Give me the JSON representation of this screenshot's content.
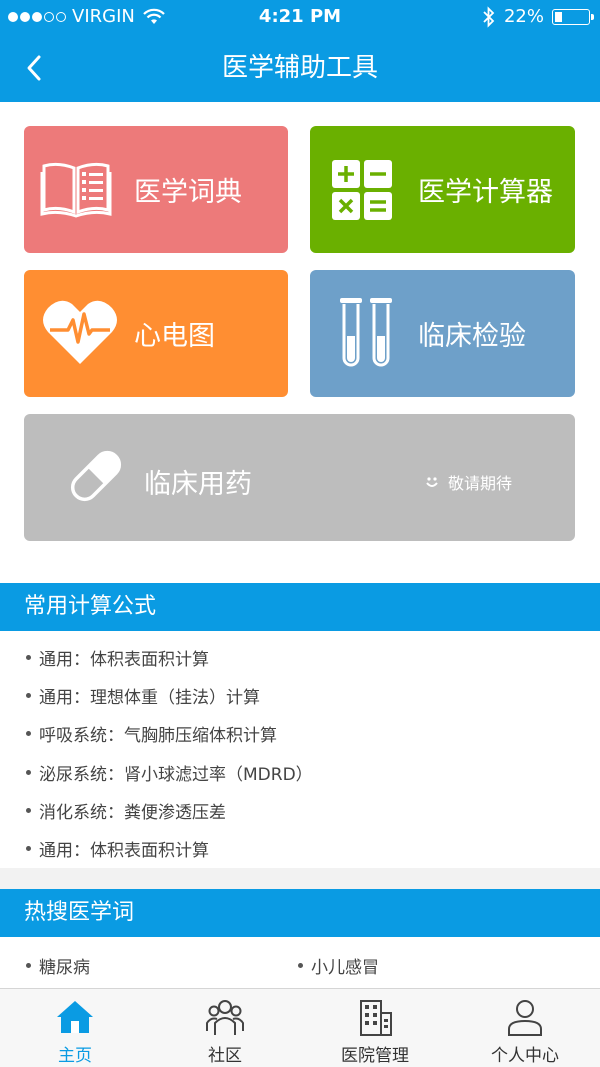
{
  "status": {
    "carrier": "VIRGIN",
    "time": "4:21 PM",
    "battery": "22%",
    "battery_level": 0.22
  },
  "nav": {
    "title": "医学辅助工具"
  },
  "tiles": {
    "dictionary": {
      "label": "医学词典",
      "color": "#ed7a7a"
    },
    "calculator": {
      "label": "医学计算器",
      "color": "#6ab000"
    },
    "ecg": {
      "label": "心电图",
      "color": "#ff8e32"
    },
    "lab": {
      "label": "临床检验",
      "color": "#6ea0c9"
    },
    "drugs": {
      "label": "临床用药",
      "coming_soon": "敬请期待",
      "color": "#bdbdbd"
    }
  },
  "formulas": {
    "title": "常用计算公式",
    "items": [
      "通用：体积表面积计算",
      "通用：理想体重（挂法）计算",
      "呼吸系统：气胸肺压缩体积计算",
      "泌尿系统：肾小球滤过率（MDRD）",
      "消化系统：粪便渗透压差",
      "通用：体积表面积计算"
    ]
  },
  "hot_terms": {
    "title": "热搜医学词",
    "items": [
      "糖尿病",
      "小儿感冒"
    ]
  },
  "tabbar": {
    "accent": "#0a9be3",
    "items": [
      {
        "label": "主页",
        "icon": "home-icon",
        "active": true
      },
      {
        "label": "社区",
        "icon": "community-icon",
        "active": false
      },
      {
        "label": "医院管理",
        "icon": "hospital-icon",
        "active": false
      },
      {
        "label": "个人中心",
        "icon": "person-icon",
        "active": false
      }
    ]
  }
}
